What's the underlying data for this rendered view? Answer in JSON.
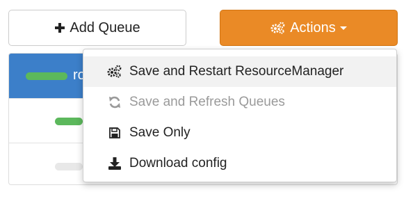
{
  "toolbar": {
    "add_queue_label": "Add Queue",
    "actions_label": "Actions",
    "add_icon": "plus-icon",
    "actions_icon": "gears-icon"
  },
  "queue_table": {
    "header_text": "ro"
  },
  "actions_menu": {
    "items": [
      {
        "label": "Save and Restart ResourceManager",
        "icon": "gears-icon",
        "highlighted": true
      },
      {
        "label": "Save and Refresh Queues",
        "icon": "refresh-icon",
        "disabled": true
      },
      {
        "label": "Save Only",
        "icon": "save-icon"
      },
      {
        "label": "Download config",
        "icon": "download-icon"
      }
    ]
  },
  "colors": {
    "accent": "#ea8a26",
    "header_blue": "#3c7fc9",
    "capacity_green": "#5cb85c"
  }
}
